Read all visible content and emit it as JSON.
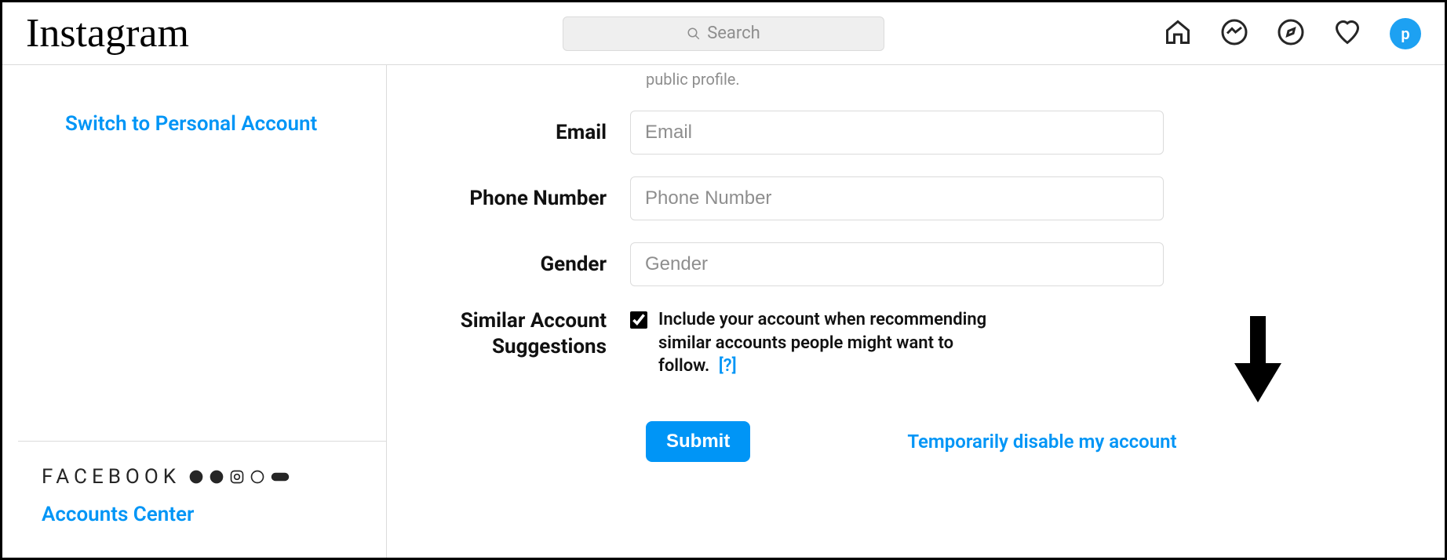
{
  "brand": "Instagram",
  "search": {
    "placeholder": "Search"
  },
  "avatar_initial": "p",
  "sidebar": {
    "switch_label": "Switch to Personal Account",
    "facebook_label": "FACEBOOK",
    "accounts_center_label": "Accounts Center"
  },
  "hint_text": "public profile.",
  "fields": {
    "email": {
      "label": "Email",
      "placeholder": "Email"
    },
    "phone": {
      "label": "Phone Number",
      "placeholder": "Phone Number"
    },
    "gender": {
      "label": "Gender",
      "placeholder": "Gender"
    }
  },
  "suggestions": {
    "label": "Similar Account Suggestions",
    "text": "Include your account when recommending similar accounts people might want to follow.",
    "help": "[?]",
    "checked": true
  },
  "actions": {
    "submit": "Submit",
    "disable": "Temporarily disable my account"
  }
}
